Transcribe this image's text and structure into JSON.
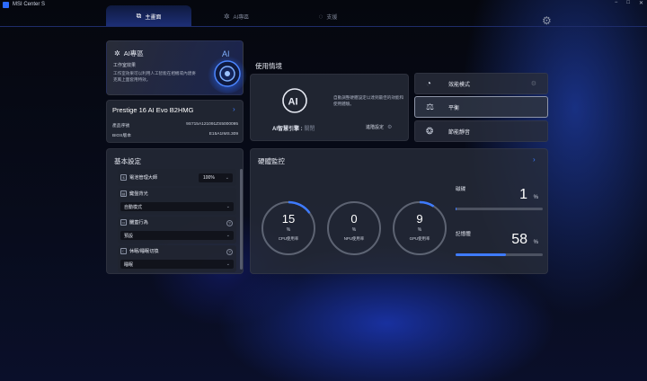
{
  "app": {
    "title": "MSI Center S",
    "brand_color": "#2c6bff"
  },
  "window_controls": [
    "−",
    "□",
    "✕"
  ],
  "nav": {
    "tabs": [
      {
        "label": "主畫面",
        "icon": "home-icon"
      },
      {
        "label": "AI專區",
        "icon": "ai-sparkle-icon"
      },
      {
        "label": "支援",
        "icon": "support-icon"
      }
    ],
    "active_tab": 0
  },
  "ai_zone": {
    "title": "AI專區",
    "subtitle": "工作室效果",
    "description": "工作室效果可以利用人工智能在相機或內建麥克風上面套用特效。"
  },
  "device": {
    "name": "Prestige 16 AI Evo B2HMG",
    "product_sn_label": "產品序號",
    "product_sn": "9S715A121091ZS5000095",
    "bios_label": "BIOS版本",
    "bios": "E15A1IMS.309"
  },
  "basic_settings": {
    "title": "基本設定",
    "battery_master": {
      "label": "電池管理大師",
      "value": "100%"
    },
    "keyboard_backlight": {
      "label": "鍵盤背光",
      "value": "自動模式"
    },
    "lid_action": {
      "label": "闔蓋行為",
      "value": "預設"
    },
    "sleep_hibernate": {
      "label": "休眠/睡眠切換",
      "value": "睡眠"
    }
  },
  "usage": {
    "title": "使用情境",
    "ai_engine_label": "AI智慧引擎 :",
    "ai_engine_state": "關閉",
    "ai_engine_desc": "自動調整硬體設定以達到最佳的效能和使用體驗。",
    "advanced_settings": "進階設定",
    "modes": [
      {
        "label": "效能模式",
        "icon": "speedometer-icon"
      },
      {
        "label": "平衡",
        "icon": "balance-scale-icon"
      },
      {
        "label": "節能靜音",
        "icon": "leaf-globe-icon"
      }
    ],
    "active_mode": 1
  },
  "hardware": {
    "title": "硬體監控",
    "cpu": {
      "value": "15",
      "unit": "%",
      "label": "CPU使用率",
      "fraction": 0.15
    },
    "npu": {
      "value": "0",
      "unit": "%",
      "label": "NPU使用率",
      "fraction": 0.0
    },
    "gpu": {
      "value": "9",
      "unit": "%",
      "label": "GPU使用率",
      "fraction": 0.09
    },
    "disk": {
      "label": "磁碟",
      "value": "1",
      "unit": "%",
      "fraction": 0.01
    },
    "memory": {
      "label": "記憶體",
      "value": "58",
      "unit": "%",
      "fraction": 0.58
    },
    "accent_color": "#3e7bff"
  }
}
